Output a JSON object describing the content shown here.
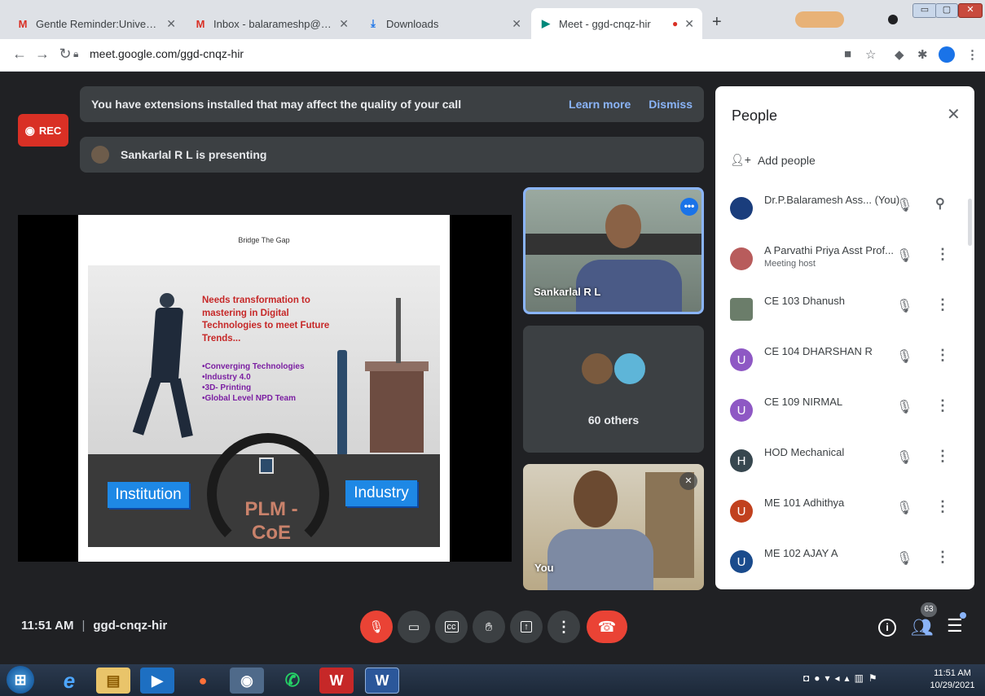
{
  "browser": {
    "tabs": [
      {
        "label": "Gentle Reminder:University Distr",
        "icon": "M"
      },
      {
        "label": "Inbox - balarameshp@gmail.com",
        "icon": "M"
      },
      {
        "label": "Downloads",
        "icon": "⤓"
      },
      {
        "label": "Meet - ggd-cnqz-hir",
        "icon": "▶"
      }
    ],
    "new_tab": "+",
    "url": "meet.google.com/ggd-cnqz-hir"
  },
  "meet": {
    "rec_label": "REC",
    "banner_text": "You have extensions installed that may affect the quality of your call",
    "learn_more": "Learn more",
    "dismiss": "Dismiss",
    "presenting_text": "Sankarlal R L is presenting",
    "slide": {
      "title": "Bridge The Gap",
      "headline": "Needs transformation to mastering in Digital Technologies to meet Future Trends...",
      "bullets": [
        "•Converging Technologies",
        "•Industry 4.0",
        "•3D- Printing",
        "•Global Level NPD Team"
      ],
      "left_label": "Institution",
      "right_label": "Industry",
      "center_label_1": "PLM -",
      "center_label_2": "CoE"
    },
    "tiles": {
      "presenter_name": "Sankarlal R L",
      "others": "60 others",
      "self_name": "You"
    },
    "time": "11:51 AM",
    "meeting_code": "ggd-cnqz-hir",
    "participant_count": "63"
  },
  "people": {
    "title": "People",
    "add_people": "Add people",
    "list": [
      {
        "name": "Dr.P.Balaramesh Ass... (You)",
        "sub": "",
        "initial": "",
        "color": "#1a3d7c"
      },
      {
        "name": "A Parvathi Priya Asst Prof...",
        "sub": "Meeting host",
        "initial": "",
        "color": "#b85c5c"
      },
      {
        "name": "CE 103 Dhanush",
        "sub": "",
        "initial": "",
        "color": "#6b7d6a"
      },
      {
        "name": "CE 104 DHARSHAN R",
        "sub": "",
        "initial": "U",
        "color": "#8e58c4"
      },
      {
        "name": "CE 109 NIRMAL",
        "sub": "",
        "initial": "U",
        "color": "#8e58c4"
      },
      {
        "name": "HOD Mechanical",
        "sub": "",
        "initial": "H",
        "color": "#37474f"
      },
      {
        "name": "ME 101 Adhithya",
        "sub": "",
        "initial": "U",
        "color": "#c1411e"
      },
      {
        "name": "ME 102 AJAY A",
        "sub": "",
        "initial": "U",
        "color": "#1a4b8c"
      }
    ]
  },
  "taskbar": {
    "time": "11:51 AM",
    "date": "10/29/2021"
  }
}
